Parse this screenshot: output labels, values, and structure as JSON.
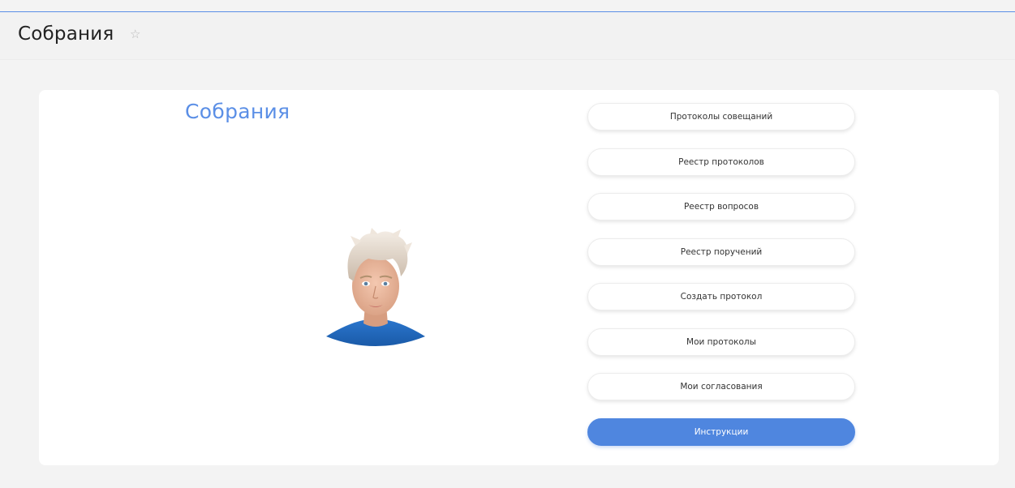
{
  "header": {
    "title": "Собрания"
  },
  "card": {
    "title": "Собрания"
  },
  "menu": {
    "items": [
      {
        "label": "Протоколы совещаний"
      },
      {
        "label": "Реестр протоколов"
      },
      {
        "label": "Реестр вопросов"
      },
      {
        "label": "Реестр поручений"
      },
      {
        "label": "Создать протокол"
      },
      {
        "label": "Мои протоколы"
      },
      {
        "label": "Мои согласования"
      }
    ],
    "instructions_label": "Инструкции"
  },
  "colors": {
    "accent": "#4f86df",
    "title_blue": "#5b8fe6",
    "shirt_blue": "#1e63b8"
  }
}
